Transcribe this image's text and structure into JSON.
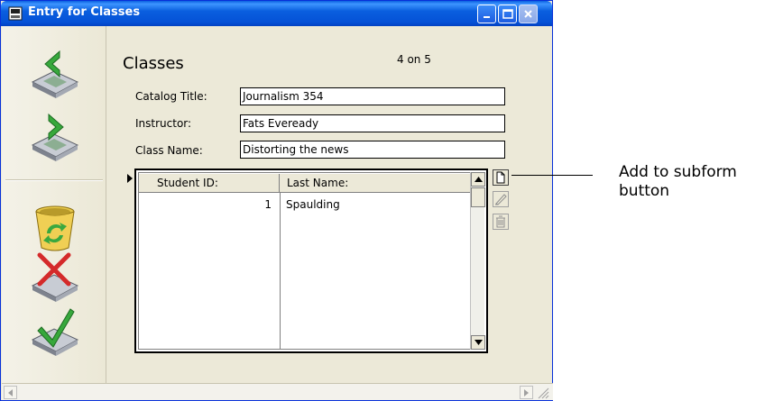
{
  "window": {
    "title": "Entry for Classes"
  },
  "form": {
    "title": "Classes",
    "record_status": "4 on 5",
    "fields": [
      {
        "label": "Catalog Title:",
        "value": "Journalism 354"
      },
      {
        "label": "Instructor:",
        "value": "Fats Eveready"
      },
      {
        "label": "Class Name:",
        "value": "Distorting the news"
      }
    ]
  },
  "subform": {
    "columns": [
      "Student ID:",
      "Last Name:"
    ],
    "rows": [
      {
        "student_id": "1",
        "last_name": "Spaulding"
      }
    ]
  },
  "toolbar": {
    "icons": [
      "previous-record-icon",
      "next-record-icon",
      "delete-record-icon",
      "cancel-icon",
      "validate-icon"
    ]
  },
  "callout": {
    "line1": "Add to subform",
    "line2": "button"
  },
  "colors": {
    "titlebar": "#0a5fdf",
    "window_bg": "#ece9d8"
  }
}
